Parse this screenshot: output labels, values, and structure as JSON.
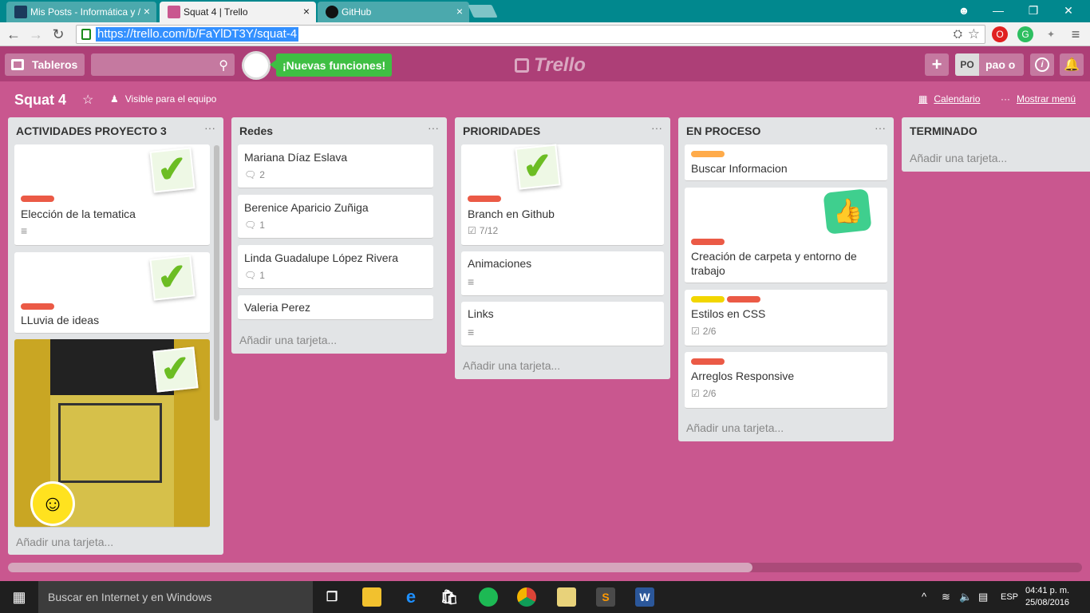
{
  "browser": {
    "tabs": [
      {
        "title": "Mis Posts - Informática y /",
        "close": "×"
      },
      {
        "title": "Squat 4 | Trello",
        "close": "×"
      },
      {
        "title": "GitHub",
        "close": "×"
      }
    ],
    "url": "https://trello.com/b/FaYlDT3Y/squat-4",
    "win_controls": {
      "minimize": "—",
      "restore": "❐",
      "close": "✕"
    }
  },
  "header": {
    "boards_button": "Tableros",
    "new_features": "¡Nuevas funciones!",
    "logo_text": "Trello",
    "add_button": "+",
    "user_initials": "PO",
    "user_name": "pao o",
    "info_button": "i",
    "notifications_icon": "bell"
  },
  "board": {
    "title": "Squat 4",
    "visibility": "Visible para el equipo",
    "calendar": "Calendario",
    "show_menu": "Mostrar menú"
  },
  "lists": [
    {
      "name": "ACTIVIDADES PROYECTO 3",
      "menu": "···",
      "add_card": "Añadir una tarjeta...",
      "cards": [
        {
          "title": "Elección de la tematica",
          "labels": [
            "#eb5a46"
          ],
          "has_description": true
        },
        {
          "title": "LLuvia de ideas",
          "labels": [
            "#eb5a46"
          ]
        },
        {
          "title": "",
          "cover": "photo"
        }
      ]
    },
    {
      "name": "Redes",
      "menu": "···",
      "add_card": "Añadir una tarjeta...",
      "cards": [
        {
          "title": "Mariana Díaz Eslava",
          "comments": "2"
        },
        {
          "title": "Berenice Aparicio Zuñiga",
          "comments": "1"
        },
        {
          "title": "Linda Guadalupe López Rivera",
          "comments": "1"
        },
        {
          "title": "Valeria Perez"
        }
      ]
    },
    {
      "name": "PRIORIDADES",
      "menu": "···",
      "add_card": "Añadir una tarjeta...",
      "cards": [
        {
          "title": "Branch en Github",
          "labels": [
            "#eb5a46"
          ],
          "checklist": "7/12"
        },
        {
          "title": "Animaciones",
          "has_description": true
        },
        {
          "title": "Links",
          "has_description": true
        }
      ]
    },
    {
      "name": "EN PROCESO",
      "menu": "···",
      "add_card": "Añadir una tarjeta...",
      "cards": [
        {
          "title": "Buscar Informacion",
          "labels": [
            "#ffab4a"
          ]
        },
        {
          "title": "Creación de carpeta y entorno de trabajo",
          "labels": [
            "#eb5a46"
          ]
        },
        {
          "title": "Estilos en CSS",
          "labels": [
            "#f2d600",
            "#eb5a46"
          ],
          "checklist": "2/6"
        },
        {
          "title": "Arreglos Responsive",
          "labels": [
            "#eb5a46"
          ],
          "checklist": "2/6"
        }
      ]
    },
    {
      "name": "TERMINADO",
      "add_card": "Añadir una tarjeta..."
    }
  ],
  "taskbar": {
    "search_placeholder": "Buscar en Internet y en Windows",
    "language": "ESP",
    "time": "04:41 p. m.",
    "date": "25/08/2016"
  }
}
